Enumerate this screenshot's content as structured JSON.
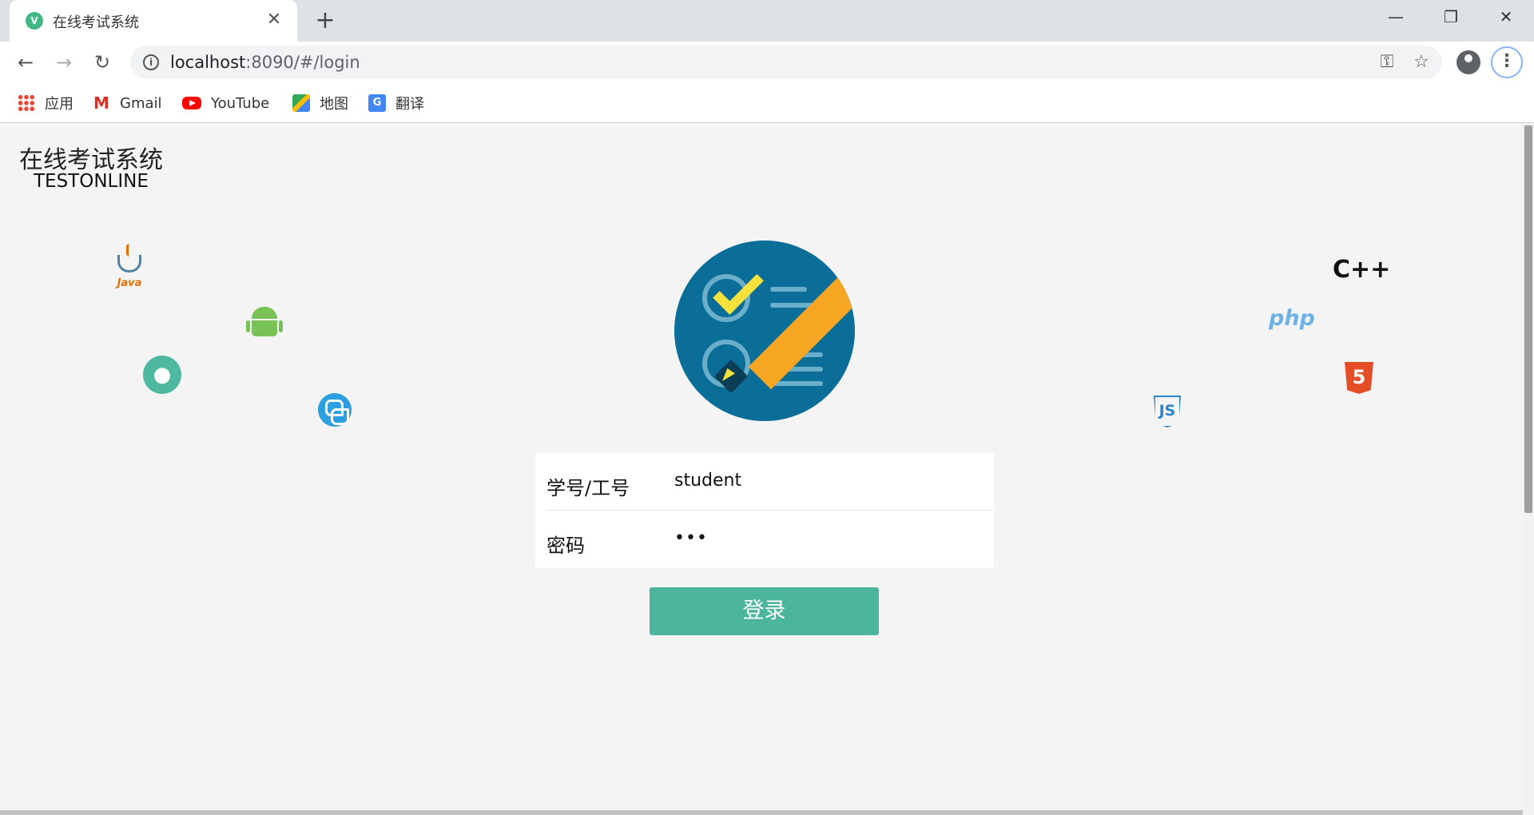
{
  "browser": {
    "tab_title": "在线考试系统",
    "tab_favicon": "V",
    "tab_close": "✕",
    "new_tab": "+",
    "url_host": "localhost",
    "url_path": ":8090/#/login",
    "window_controls": {
      "minimize": "—",
      "restore": "❐",
      "close": "✕"
    },
    "nav": {
      "back": "←",
      "forward": "→",
      "reload": "↻"
    },
    "omnibox_icons": [
      "key-icon",
      "star-icon"
    ],
    "key_glyph": "⚿",
    "star_glyph": "☆",
    "menu_glyph": "⋮"
  },
  "bookmarks": [
    {
      "label": "应用",
      "icon": "apps-icon"
    },
    {
      "label": "Gmail",
      "icon": "gmail-icon"
    },
    {
      "label": "YouTube",
      "icon": "youtube-icon"
    },
    {
      "label": "地图",
      "icon": "maps-icon"
    },
    {
      "label": "翻译",
      "icon": "translate-icon"
    }
  ],
  "brand": {
    "title": "在线考试系统",
    "subtitle": "TESTONLINE"
  },
  "tech_icons": {
    "java_label": "Java",
    "apple_glyph": "",
    "cpp_label": "C++",
    "php_label": "php",
    "html5_label": "5",
    "js_label": "JS"
  },
  "login_form": {
    "username_label": "学号/工号",
    "username_value": "student",
    "password_label": "密码",
    "password_masked": "•••",
    "submit_label": "登录"
  },
  "colors": {
    "accent": "#4cb69d",
    "logo_bg": "#0b6e99",
    "page_bg": "#f4f4f4"
  }
}
